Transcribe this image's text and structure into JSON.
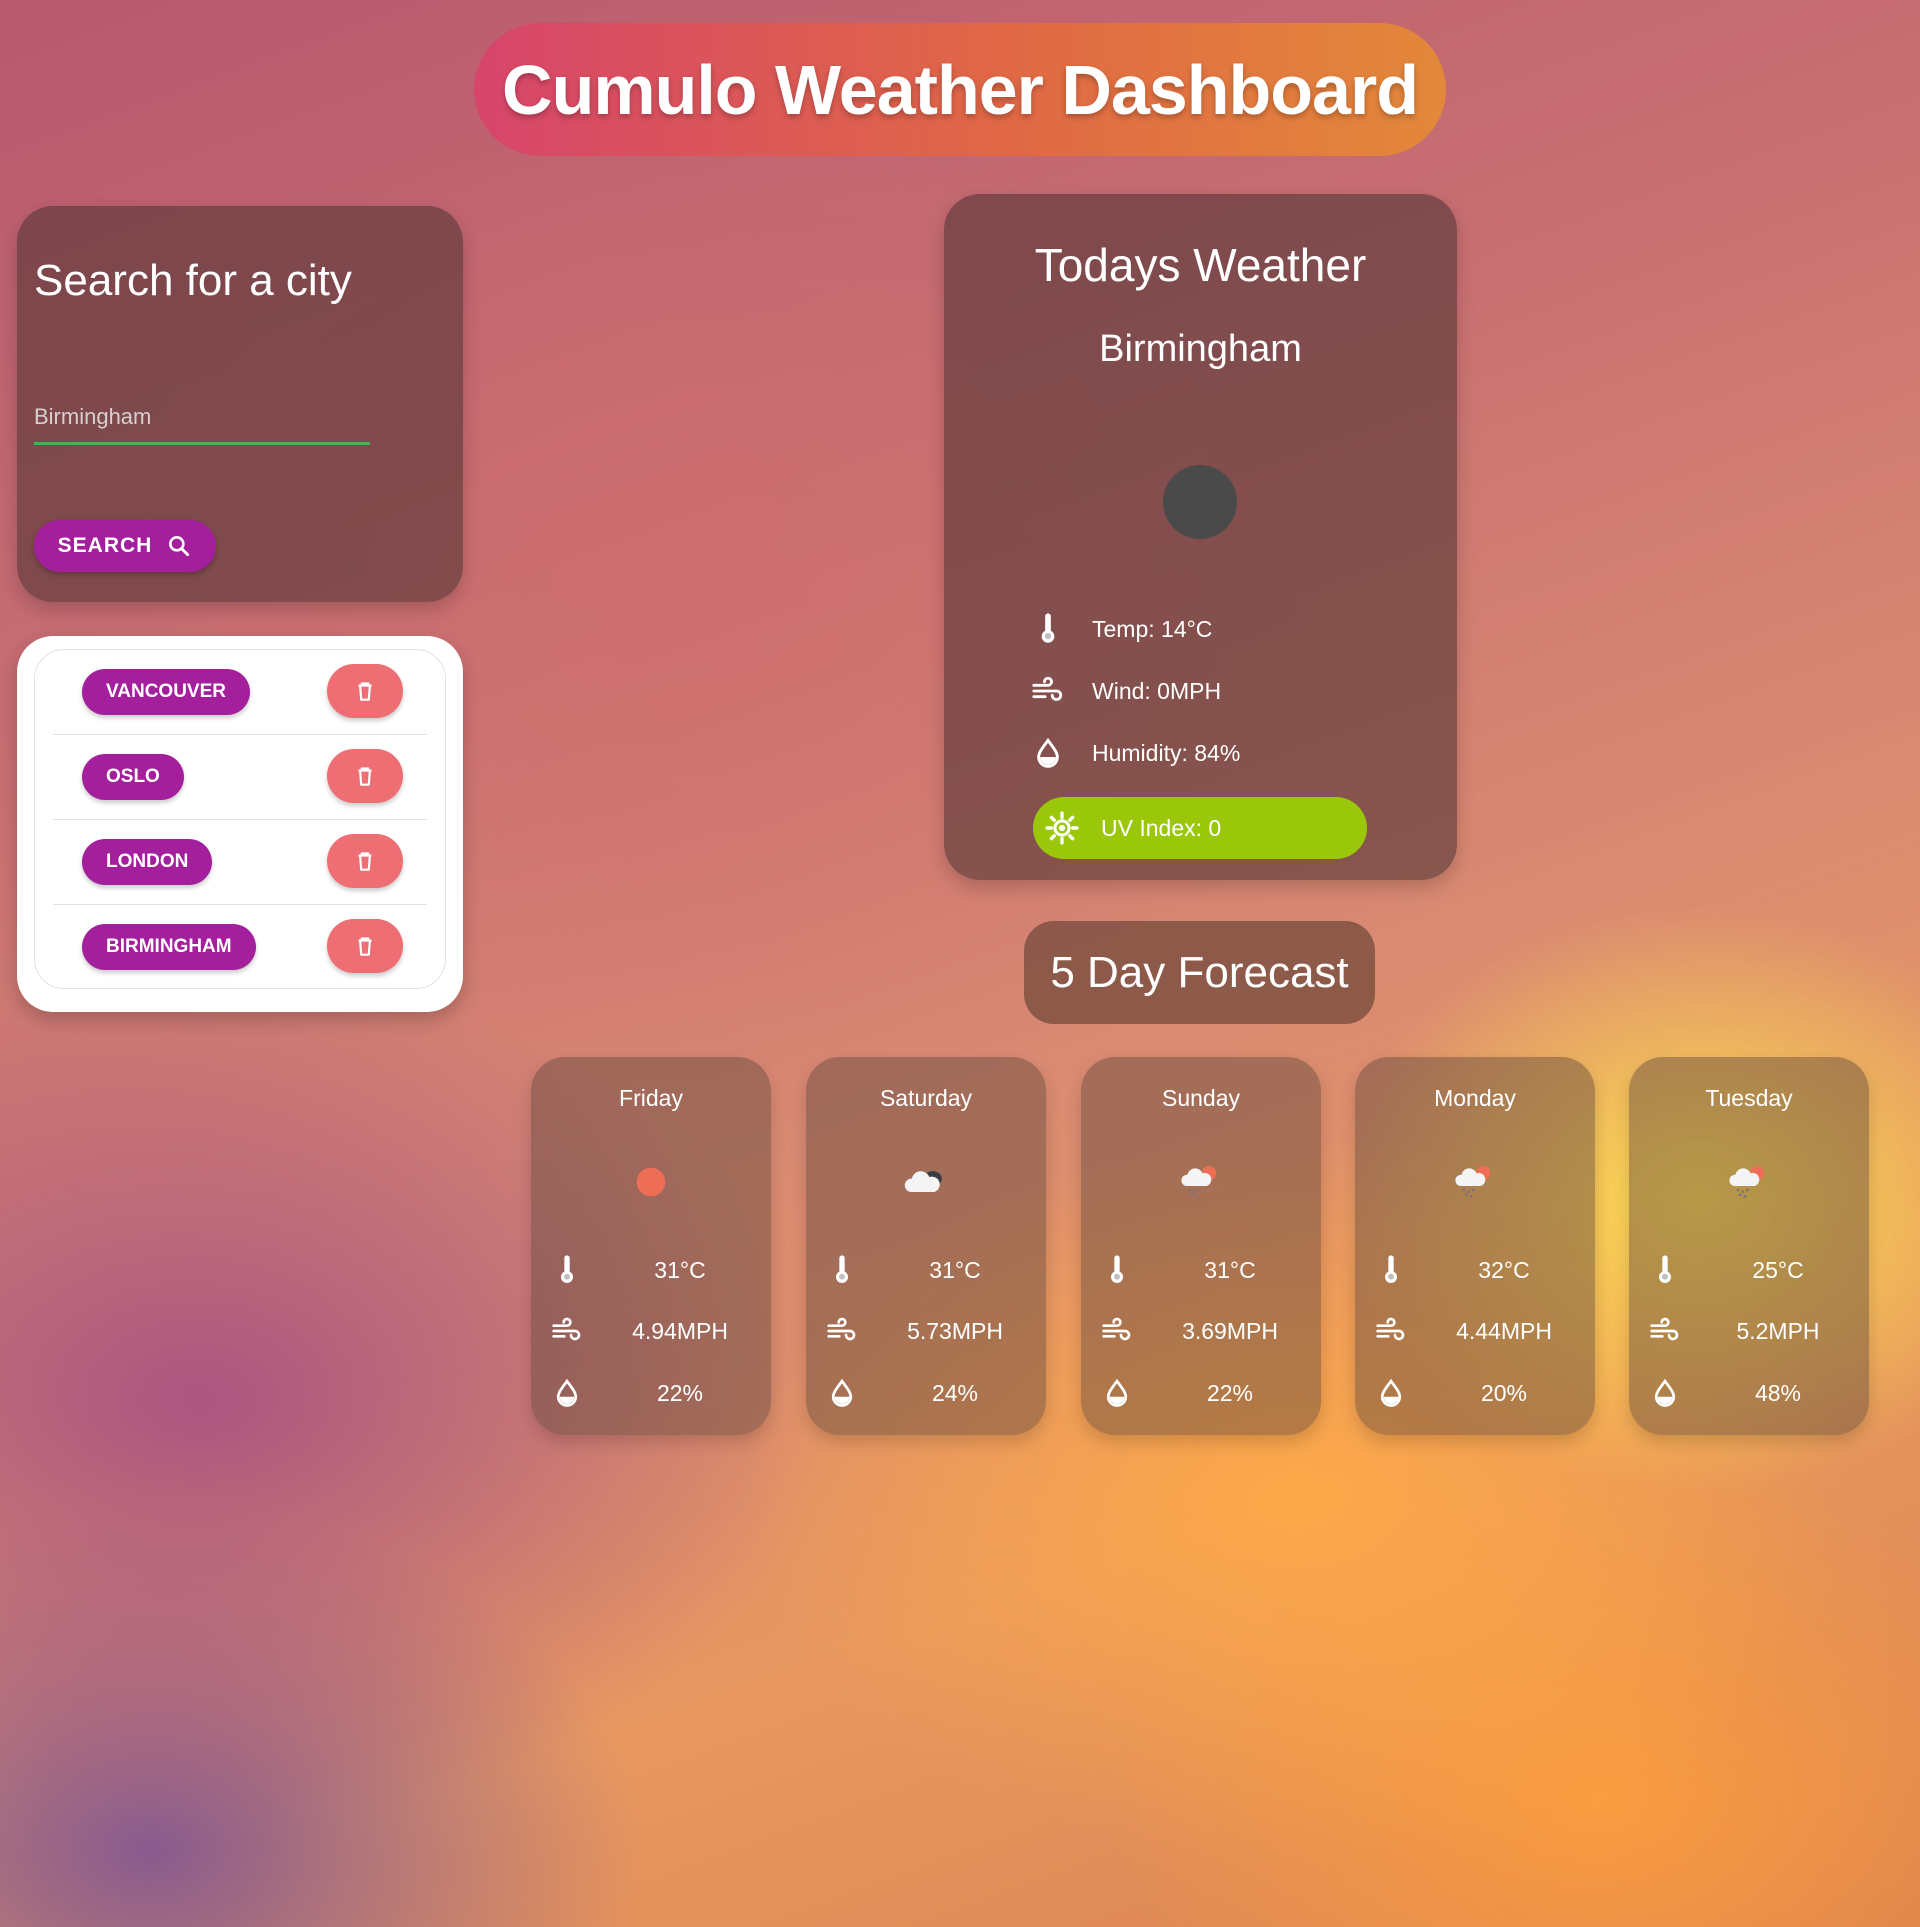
{
  "header": {
    "title": "Cumulo Weather Dashboard"
  },
  "search": {
    "title": "Search for a city",
    "placeholder": "Birmingham",
    "value": "",
    "button_label": "SEARCH"
  },
  "history": {
    "cities": [
      "VANCOUVER",
      "OSLO",
      "LONDON",
      "BIRMINGHAM"
    ]
  },
  "today": {
    "title": "Todays Weather",
    "city": "Birmingham",
    "temp": "Temp: 14°C",
    "wind": "Wind: 0MPH",
    "humidity": "Humidity: 84%",
    "uv": "UV Index: 0",
    "uv_color": "#9ac70a"
  },
  "forecast": {
    "heading": "5 Day Forecast",
    "days": [
      {
        "day": "Friday",
        "icon": "sun-icon",
        "temp": "31°C",
        "wind": "4.94MPH",
        "humidity": "22%"
      },
      {
        "day": "Saturday",
        "icon": "cloud-icon",
        "temp": "31°C",
        "wind": "5.73MPH",
        "humidity": "24%"
      },
      {
        "day": "Sunday",
        "icon": "rain-sun-icon",
        "temp": "31°C",
        "wind": "3.69MPH",
        "humidity": "22%"
      },
      {
        "day": "Monday",
        "icon": "rain-sun-icon",
        "temp": "32°C",
        "wind": "4.44MPH",
        "humidity": "20%"
      },
      {
        "day": "Tuesday",
        "icon": "rain-sun-icon",
        "temp": "25°C",
        "wind": "5.2MPH",
        "humidity": "48%"
      }
    ]
  },
  "colors": {
    "accent": "#a31f9c",
    "delete": "#ee6e73",
    "input_underline": "#4caf50"
  }
}
